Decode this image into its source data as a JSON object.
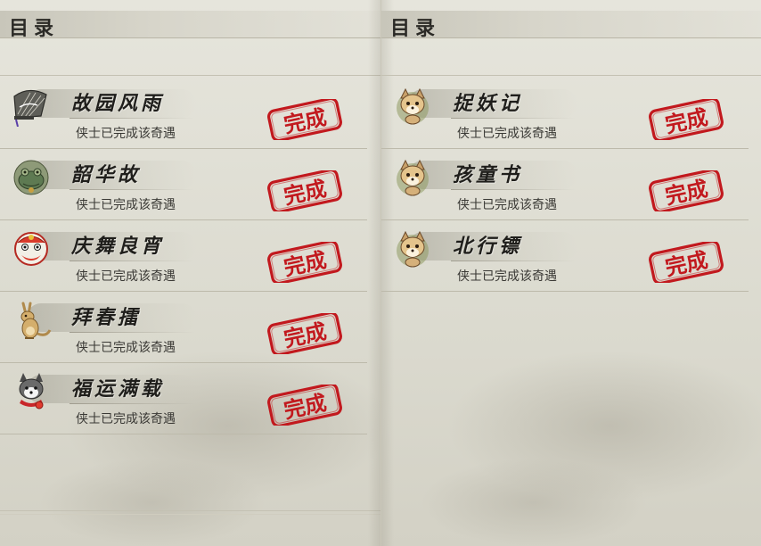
{
  "left_page": {
    "header": "目录",
    "entries": [
      {
        "title": "故园风雨",
        "status": "侠士已完成该奇遇",
        "icon": "folding-fan-icon",
        "stamp": "完成"
      },
      {
        "title": "韶华故",
        "status": "侠士已完成该奇遇",
        "icon": "jade-frog-icon",
        "stamp": "完成"
      },
      {
        "title": "庆舞良宵",
        "status": "侠士已完成该奇遇",
        "icon": "lion-dance-icon",
        "stamp": "完成"
      },
      {
        "title": "拜春擂",
        "status": "侠士已完成该奇遇",
        "icon": "kangaroo-icon",
        "stamp": "完成"
      },
      {
        "title": "福运满载",
        "status": "侠士已完成该奇遇",
        "icon": "husky-dog-icon",
        "stamp": "完成"
      }
    ]
  },
  "right_page": {
    "header": "目录",
    "entries": [
      {
        "title": "捉妖记",
        "status": "侠士已完成该奇遇",
        "icon": "fox-spirit-icon",
        "stamp": "完成"
      },
      {
        "title": "孩童书",
        "status": "侠士已完成该奇遇",
        "icon": "fox-spirit-icon",
        "stamp": "完成"
      },
      {
        "title": "北行镖",
        "status": "侠士已完成该奇遇",
        "icon": "fox-spirit-icon",
        "stamp": "完成"
      }
    ]
  },
  "colors": {
    "stamp_red": "#c2191e",
    "paper": "#dcdbd0",
    "ink": "#1f1e1b"
  }
}
